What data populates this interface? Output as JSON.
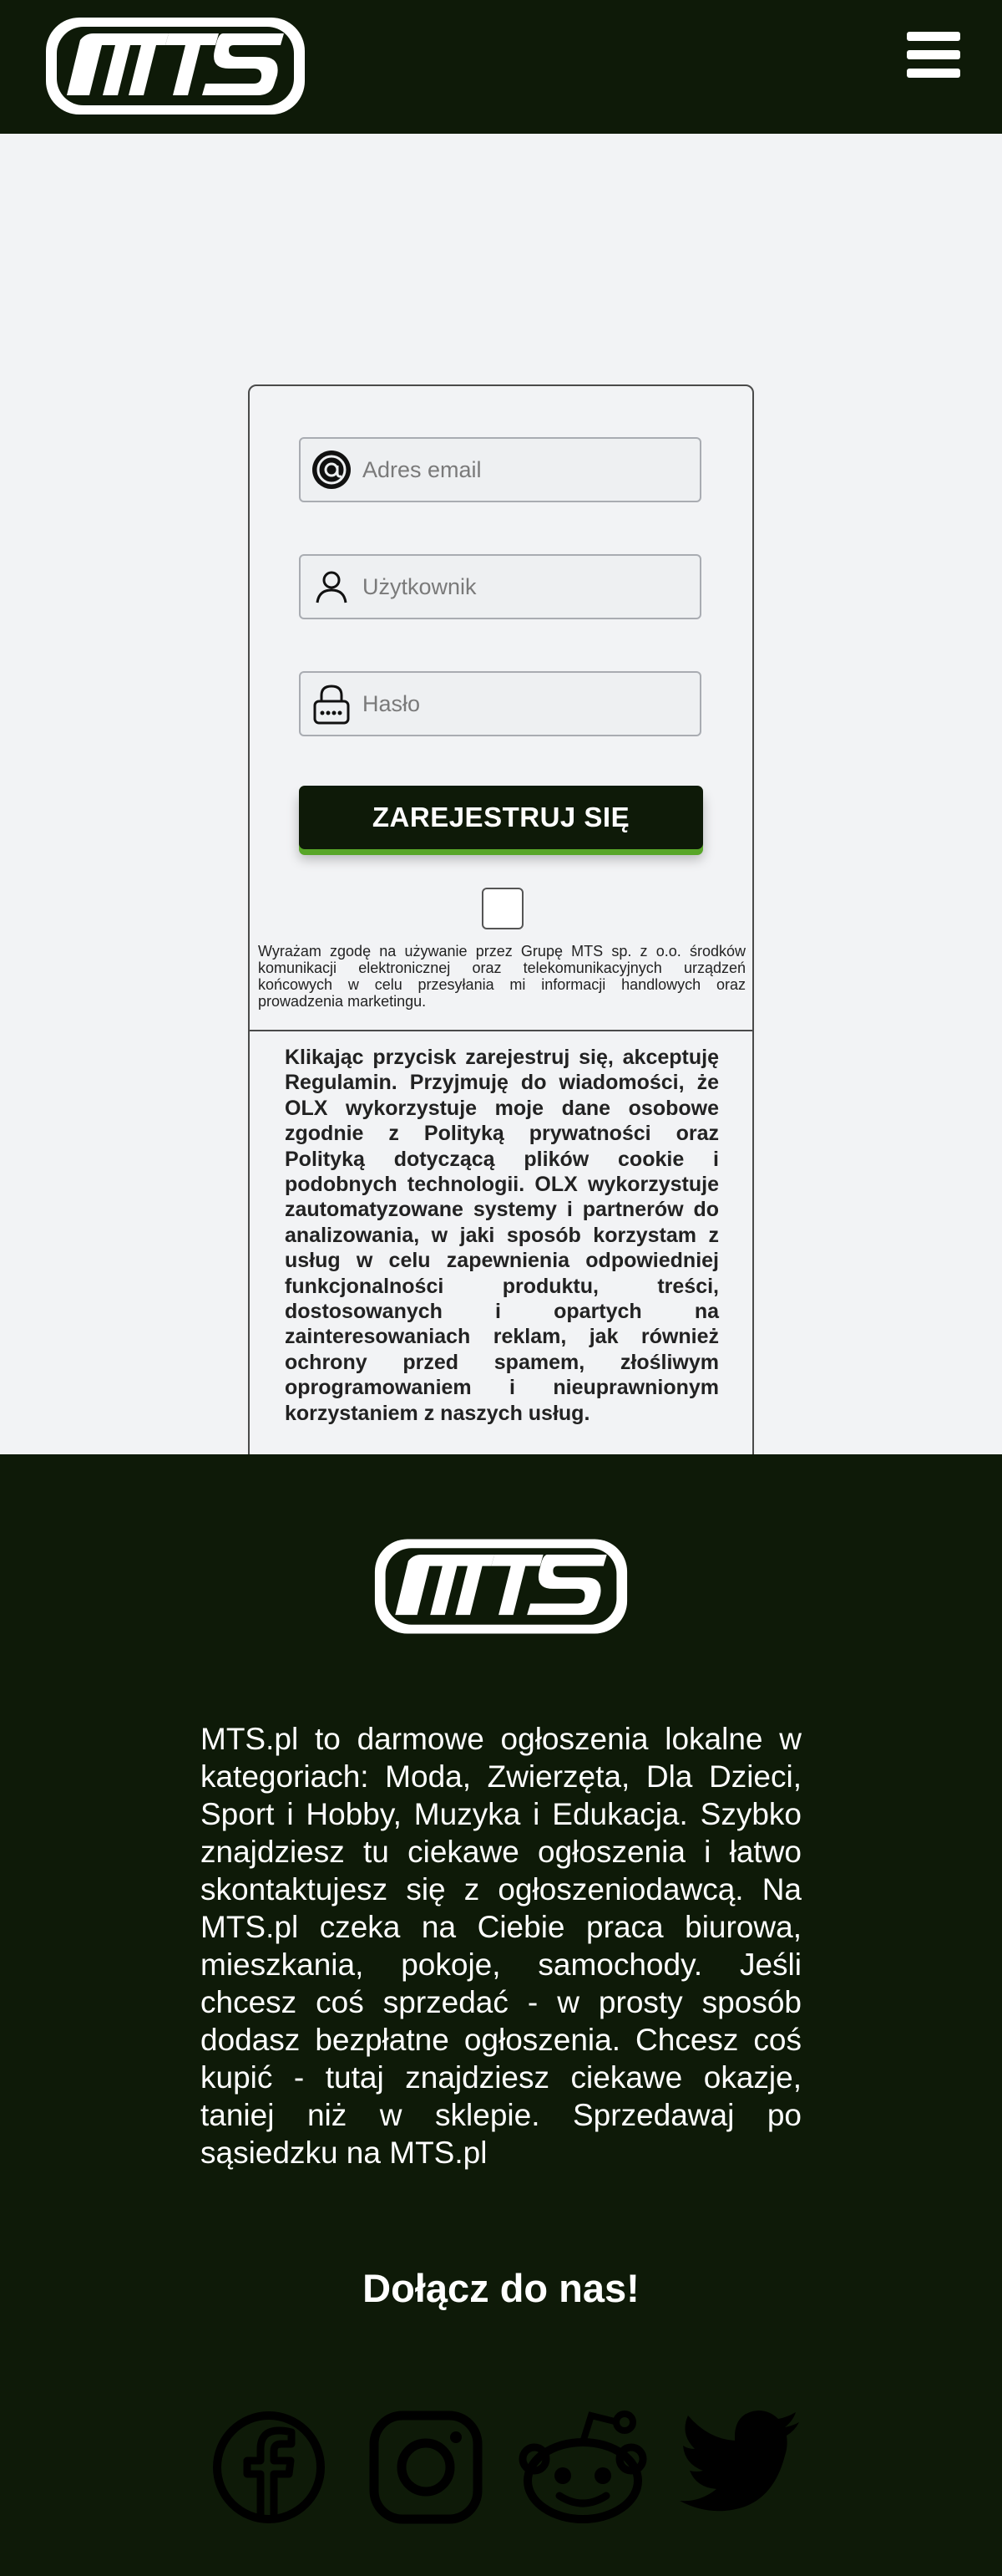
{
  "header": {
    "logo_text": "MTS",
    "menu_icon": "hamburger-menu-icon"
  },
  "form": {
    "email_placeholder": "Adres email",
    "email_icon": "at-sign-icon",
    "username_placeholder": "Użytkownik",
    "username_icon": "user-icon",
    "password_placeholder": "Hasło",
    "password_icon": "lock-icon",
    "register_label": "ZAREJESTRUJ SIĘ",
    "consent_text": "Wyrażam zgodę na używanie przez Grupę MTS sp. z o.o. środków komunikacji elektronicznej oraz telekomunikacyjnych urządzeń końcowych w celu przesyłania mi informacji handlowych oraz prowadzenia marketingu.",
    "terms_text": "Klikając przycisk zarejestruj się, akceptuję Regulamin. Przyjmuję do wiadomości, że OLX wykorzystuje moje dane osobowe zgodnie z Polityką prywatności oraz Polityką dotyczącą plików cookie i podobnych technologii. OLX wykorzystuje zautomatyzowane systemy i partnerów do analizowania, w jaki sposób korzystam z usług w celu zapewnienia odpowiedniej funkcjonalności produktu, treści, dostosowanych i opartych na zainteresowaniach reklam, jak również ochrony przed spamem, złośliwym oprogramowaniem i nieuprawnionym korzystaniem z naszych usług."
  },
  "footer": {
    "logo_text": "MTS",
    "description": "MTS.pl to darmowe ogłoszenia lokalne w kategoriach: Moda, Zwierzęta, Dla Dzieci, Sport i Hobby, Muzyka i Edukacja. Szybko znajdziesz tu ciekawe ogłoszenia i łatwo skontaktujesz się z ogłoszeniodawcą. Na MTS.pl czeka na Ciebie praca biurowa, mieszkania, pokoje, samochody. Jeśli chcesz coś sprzedać - w prosty sposób dodasz bezpłatne ogłoszenia. Chcesz coś kupić - tutaj znajdziesz ciekawe okazje, taniej niż w sklepie. Sprzedawaj po sąsiedzku na MTS.pl",
    "join_text": "Dołącz do nas!",
    "social": [
      "facebook-icon",
      "instagram-icon",
      "reddit-icon",
      "twitter-icon"
    ]
  },
  "colors": {
    "dark_green": "#0e1a08",
    "accent_green": "#58a628",
    "page_bg": "#f2f3f5"
  }
}
